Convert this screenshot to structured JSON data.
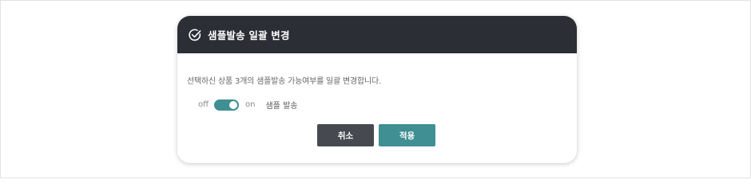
{
  "modal": {
    "title": "샘플발송 일괄 변경",
    "icon": "check-circle-icon",
    "description": "선택하신 상품 3개의 샘플발송 가능여부를 일괄 변경합니다."
  },
  "toggle": {
    "off_label": "off",
    "on_label": "on",
    "state": "on",
    "label": "샘플 발송"
  },
  "buttons": {
    "cancel": "취소",
    "apply": "적용"
  },
  "colors": {
    "header_bg": "#2b2e35",
    "accent": "#3f8f93",
    "cancel_bg": "#464a50"
  }
}
